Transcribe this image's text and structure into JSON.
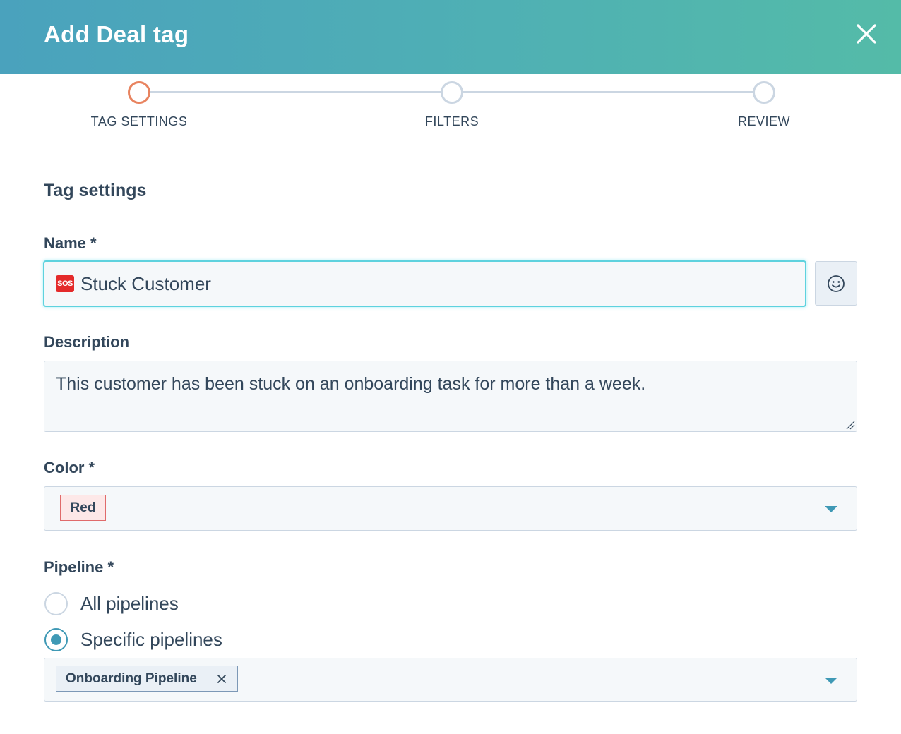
{
  "header": {
    "title": "Add Deal tag"
  },
  "stepper": {
    "steps": [
      {
        "label": "TAG SETTINGS",
        "active": true
      },
      {
        "label": "FILTERS",
        "active": false
      },
      {
        "label": "REVIEW",
        "active": false
      }
    ]
  },
  "form": {
    "section_title": "Tag settings",
    "name": {
      "label": "Name *",
      "value": "Stuck Customer",
      "emoji": "SOS"
    },
    "description": {
      "label": "Description",
      "value": "This customer has been stuck on an onboarding task for more than a week."
    },
    "color": {
      "label": "Color *",
      "value": "Red"
    },
    "pipeline": {
      "label": "Pipeline *",
      "options": [
        {
          "label": "All pipelines",
          "checked": false
        },
        {
          "label": "Specific pipelines",
          "checked": true
        }
      ],
      "selected": [
        "Onboarding Pipeline"
      ]
    }
  },
  "colors": {
    "header_gradient_start": "#4aa2bd",
    "header_gradient_end": "#54bba8",
    "active_step": "#e8835f",
    "accent": "#3f99b5",
    "focus_border": "#5ed2de",
    "red_tag_bg": "#fde8e8",
    "red_tag_border": "#e06b6b"
  },
  "icons": {
    "close": "close-icon",
    "emoji": "smiley-icon",
    "caret": "caret-down-icon",
    "remove": "remove-x-icon"
  }
}
